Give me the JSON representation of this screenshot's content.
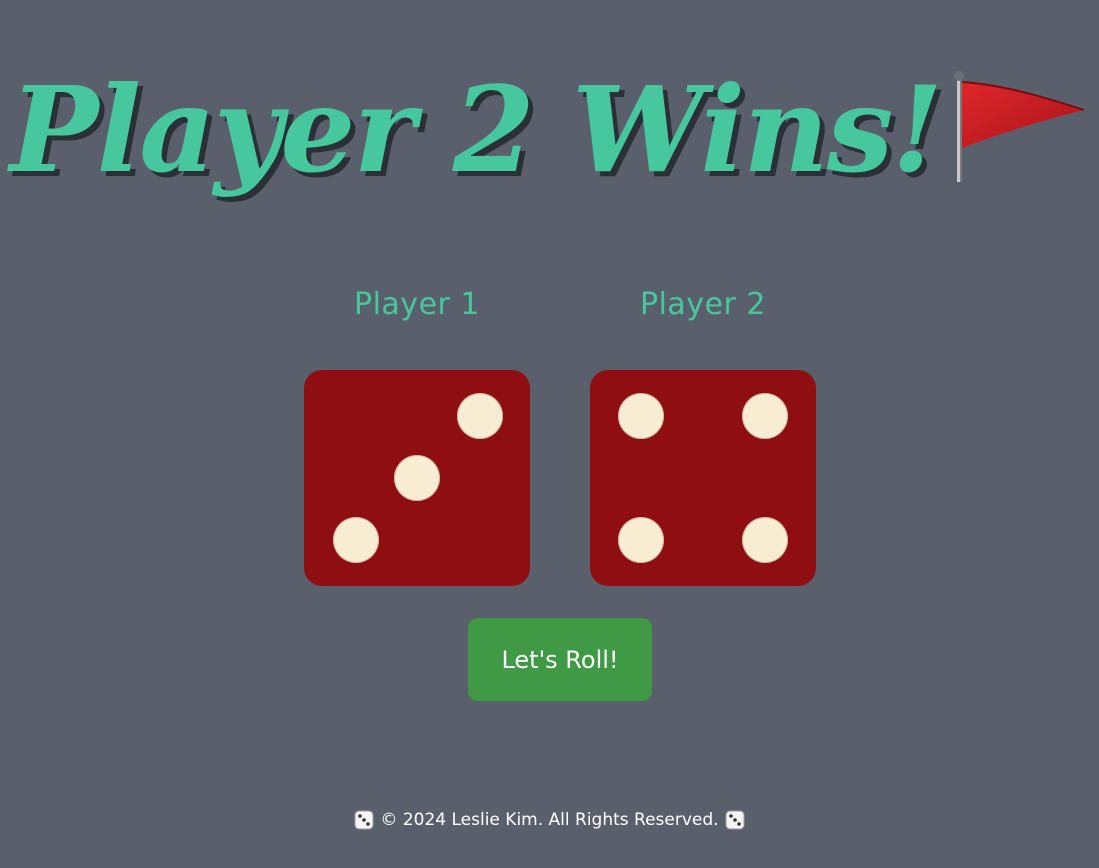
{
  "header": {
    "title": "Player 2 Wins!",
    "title_icon": "red-flag-icon"
  },
  "players": [
    {
      "label": "Player 1",
      "die_value": 3
    },
    {
      "label": "Player 2",
      "die_value": 4
    }
  ],
  "controls": {
    "roll_label": "Let's Roll!"
  },
  "footer": {
    "text": "© 2024 Leslie Kim. All Rights Reserved.",
    "icon": "die-icon"
  },
  "colors": {
    "background": "#5a606b",
    "title": "#46c79d",
    "die": "#8e0e12",
    "pip": "#f8ecd2",
    "button": "#3f9945"
  }
}
